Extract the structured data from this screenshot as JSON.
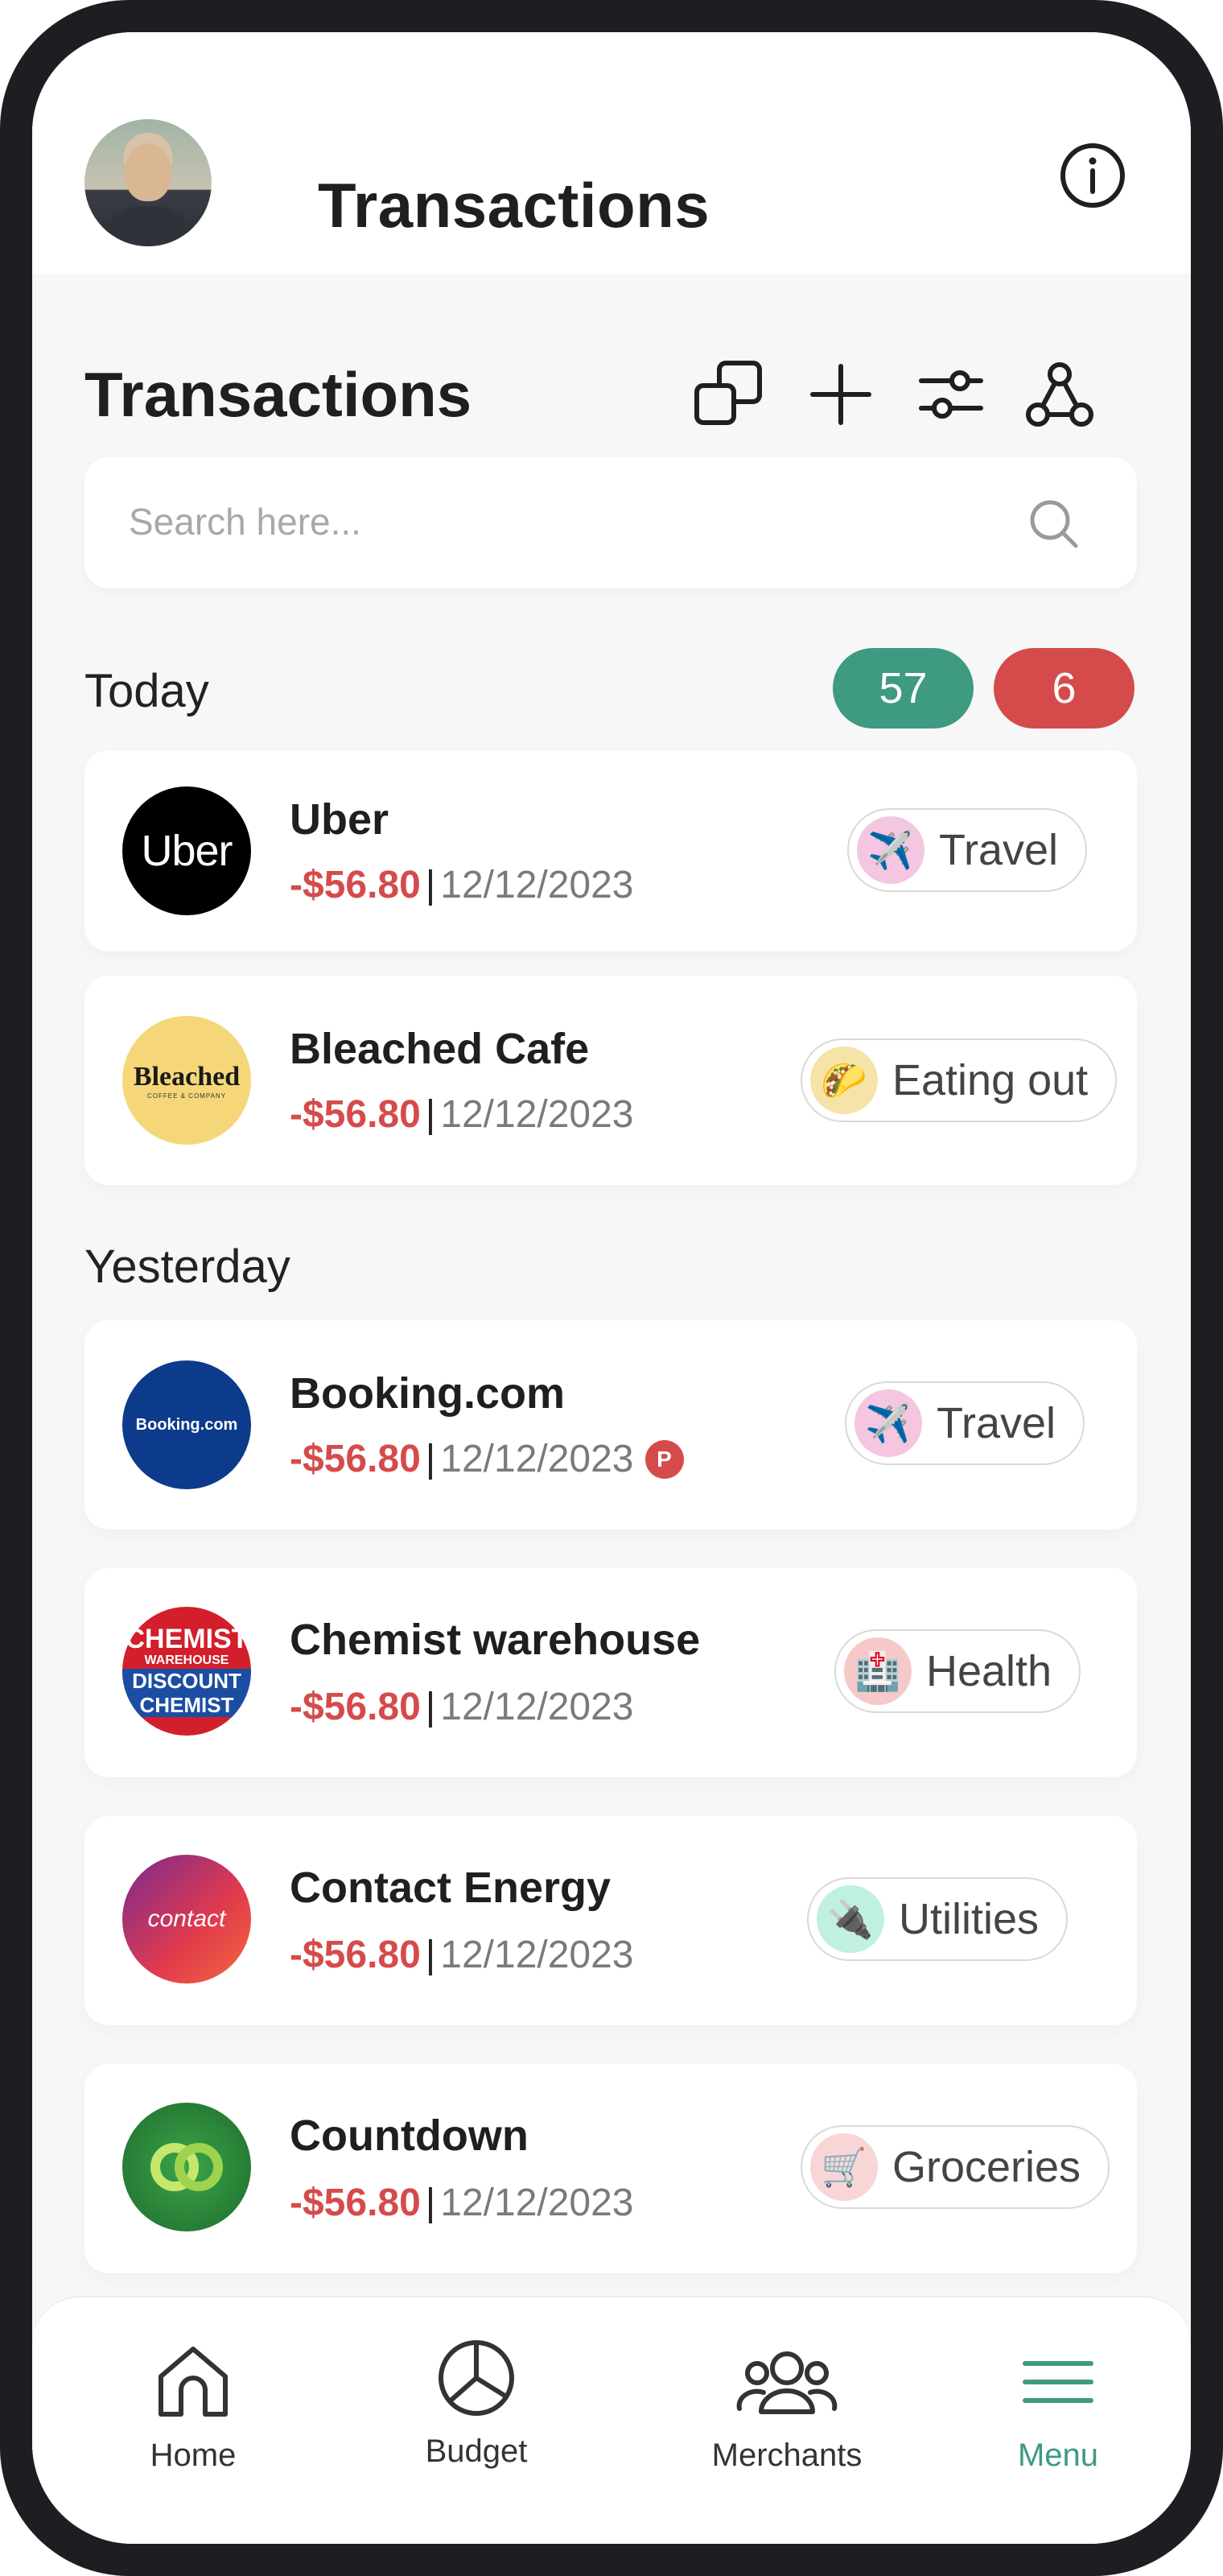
{
  "appbar": {
    "title": "Transactions",
    "info_icon": "info-icon",
    "avatar_icon": "user-avatar"
  },
  "section": {
    "title": "Transactions",
    "tools": [
      "copy-icon",
      "plus-icon",
      "sliders-icon",
      "network-icon"
    ]
  },
  "search": {
    "placeholder": "Search here...",
    "value": "",
    "icon": "search-icon"
  },
  "groups": {
    "today": {
      "label": "Today",
      "count_green": "57",
      "count_red": "6"
    },
    "yesterday": {
      "label": "Yesterday"
    }
  },
  "transactions": [
    {
      "merchant": "Uber",
      "amount": "-$56.80",
      "separator": "|",
      "date": "12/12/2023",
      "logo_text": "Uber",
      "category": "Travel",
      "category_icon": "airplane-icon",
      "category_color": "#f4c6e0"
    },
    {
      "merchant": "Bleached Cafe",
      "amount": "-$56.80",
      "separator": "|",
      "date": "12/12/2023",
      "logo_text": "Bleached",
      "logo_subtext": "COFFEE & COMPANY",
      "category": "Eating out",
      "category_icon": "taco-icon",
      "category_color": "#f6e3a8"
    },
    {
      "merchant": "Booking.com",
      "amount": "-$56.80",
      "separator": "|",
      "date": "12/12/2023",
      "logo_text": "Booking.com",
      "flag": "P",
      "category": "Travel",
      "category_icon": "airplane-icon",
      "category_color": "#f4c6e0"
    },
    {
      "merchant": "Chemist warehouse",
      "amount": "-$56.80",
      "separator": "|",
      "date": "12/12/2023",
      "logo_text": "CHEMIST",
      "logo_text2": "WAREHOUSE",
      "logo_text3": "DISCOUNT",
      "logo_text4": "CHEMIST",
      "category": "Health",
      "category_icon": "hospital-icon",
      "category_color": "#f6c9c9"
    },
    {
      "merchant": "Contact Energy",
      "amount": "-$56.80",
      "separator": "|",
      "date": "12/12/2023",
      "logo_text": "contact",
      "category": "Utilities",
      "category_icon": "plug-icon",
      "category_color": "#bff0e2"
    },
    {
      "merchant": "Countdown",
      "amount": "-$56.80",
      "separator": "|",
      "date": "12/12/2023",
      "logo_text": "",
      "category": "Groceries",
      "category_icon": "shopping-cart-icon",
      "category_color": "#f8d6d6"
    }
  ],
  "nav": [
    {
      "label": "Home",
      "icon": "home-icon"
    },
    {
      "label": "Budget",
      "icon": "pie-chart-icon"
    },
    {
      "label": "Merchants",
      "icon": "users-icon"
    },
    {
      "label": "Menu",
      "icon": "menu-icon",
      "active": true
    }
  ],
  "colors": {
    "accent": "#3f9a82",
    "negative": "#d54b4b",
    "frame": "#1e1e22"
  }
}
